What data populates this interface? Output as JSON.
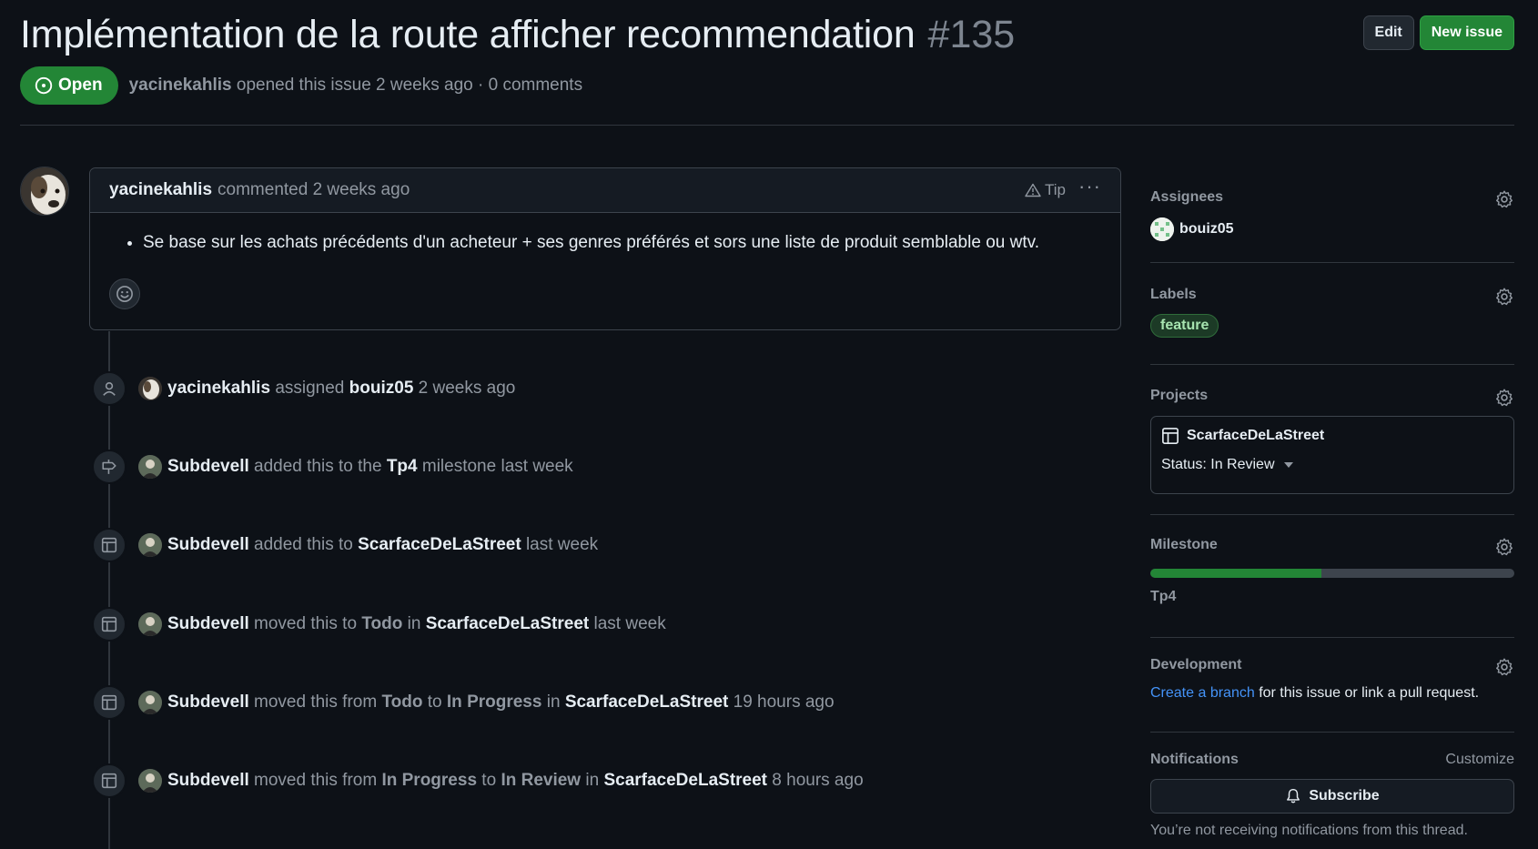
{
  "issue": {
    "title": "Implémentation de la route afficher recommendation",
    "number": "#135",
    "state": "Open",
    "author": "yacinekahlis",
    "opened_text": "opened this issue 2 weeks ago · 0 comments"
  },
  "header": {
    "edit_label": "Edit",
    "new_issue_label": "New issue"
  },
  "comment": {
    "author": "yacinekahlis",
    "meta": "commented 2 weeks ago",
    "tip_label": "Tip",
    "body": "Se base sur les achats précédents d'un acheteur + ses genres préférés et sors une liste de produit semblable ou wtv."
  },
  "events": [
    {
      "icon": "person-icon",
      "actor": "yacinekahlis",
      "t1": "assigned",
      "e1": "bouiz05",
      "t2": "2 weeks ago"
    },
    {
      "icon": "milestone-icon",
      "actor": "Subdevell",
      "t1": "added this to the",
      "e1": "Tp4",
      "t2": "milestone last week"
    },
    {
      "icon": "project-table-icon",
      "actor": "Subdevell",
      "t1": "added this to",
      "e1": "ScarfaceDeLaStreet",
      "t2": "last week"
    },
    {
      "icon": "project-table-icon",
      "actor": "Subdevell",
      "t1": "moved this to",
      "e1": "Todo",
      "t2": "in",
      "e2": "ScarfaceDeLaStreet",
      "t3": "last week"
    },
    {
      "icon": "project-table-icon",
      "actor": "Subdevell",
      "t1": "moved this from",
      "e1": "Todo",
      "t2": "to",
      "e2": "In Progress",
      "t3": "in",
      "e3": "ScarfaceDeLaStreet",
      "t4": "19 hours ago"
    },
    {
      "icon": "project-table-icon",
      "actor": "Subdevell",
      "t1": "moved this from",
      "e1": "In Progress",
      "t2": "to",
      "e2": "In Review",
      "t3": "in",
      "e3": "ScarfaceDeLaStreet",
      "t4": "8 hours ago"
    }
  ],
  "sidebar": {
    "assignees": {
      "title": "Assignees",
      "name": "bouiz05"
    },
    "labels": {
      "title": "Labels",
      "label": "feature",
      "label_color": "#1c3a26"
    },
    "projects": {
      "title": "Projects",
      "name": "ScarfaceDeLaStreet",
      "status": "Status: In Review"
    },
    "milestone": {
      "title": "Milestone",
      "name": "Tp4",
      "progress_percent": 47
    },
    "development": {
      "title": "Development",
      "link_text": "Create a branch",
      "rest_text": "for this issue or link a pull request."
    },
    "notifications": {
      "title": "Notifications",
      "customize_label": "Customize",
      "subscribe_label": "Subscribe",
      "info_text": "You’re not receiving notifications from this thread."
    }
  },
  "colors": {
    "accent_green": "#238636",
    "link_blue": "#4493f8",
    "background": "#0d1117"
  }
}
